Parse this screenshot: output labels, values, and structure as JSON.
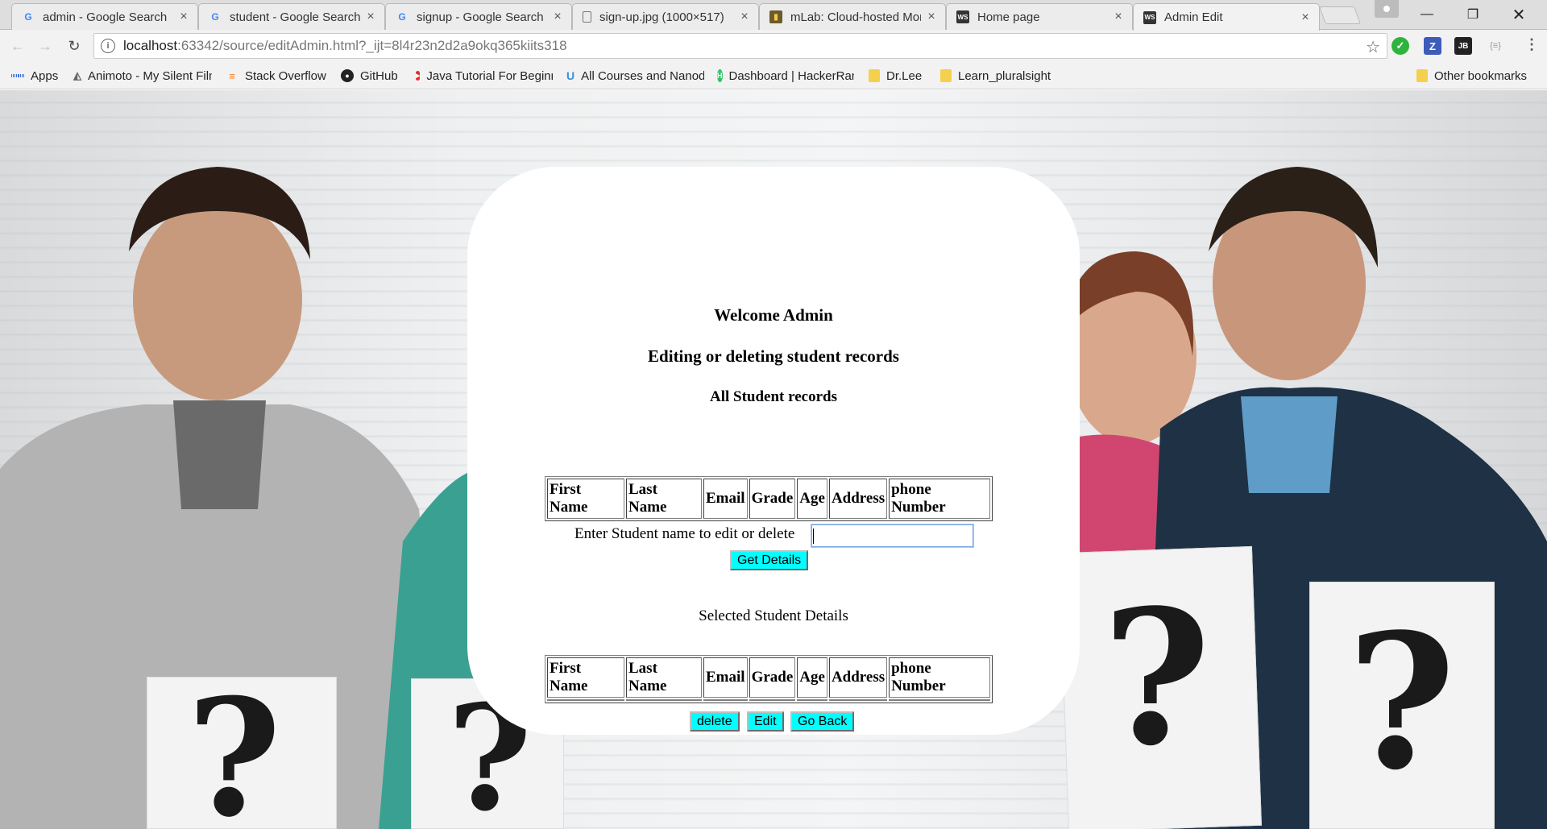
{
  "browser": {
    "tabs": [
      {
        "title": "admin - Google Search",
        "icon": "google-icon"
      },
      {
        "title": "student - Google Search",
        "icon": "google-icon"
      },
      {
        "title": "signup - Google Search",
        "icon": "google-icon"
      },
      {
        "title": "sign-up.jpg (1000×517)",
        "icon": "document-icon"
      },
      {
        "title": "mLab: Cloud-hosted MongoDB",
        "icon": "mlab-icon"
      },
      {
        "title": "Home page",
        "icon": "webstorm-icon"
      },
      {
        "title": "Admin Edit",
        "icon": "webstorm-icon",
        "active": true
      }
    ],
    "address": {
      "host": "localhost",
      "path": ":63342/source/editAdmin.html?_ijt=8l4r23n2d2a9okq365kiits318"
    },
    "bookmarks": [
      {
        "label": "Apps",
        "icon": "apps-grid-icon"
      },
      {
        "label": "Animoto - My Silent Film",
        "icon": "animoto-icon"
      },
      {
        "label": "Stack Overflow",
        "icon": "stackoverflow-icon"
      },
      {
        "label": "GitHub",
        "icon": "github-icon"
      },
      {
        "label": "Java Tutorial For Beginners",
        "icon": "youtube-icon"
      },
      {
        "label": "All Courses and Nanodegrees",
        "icon": "udacity-icon"
      },
      {
        "label": "Dashboard | HackerRank",
        "icon": "hackerrank-icon"
      },
      {
        "label": "Dr.Lee",
        "icon": "folder-icon"
      },
      {
        "label": "Learn_pluralsight",
        "icon": "folder-icon"
      }
    ],
    "other_bookmarks": "Other bookmarks"
  },
  "page": {
    "welcome": "Welcome Admin",
    "subtitle": "Editing or deleting student records",
    "all_records_heading": "All Student records",
    "columns": [
      "First Name",
      "Last Name",
      "Email",
      "Grade",
      "Age",
      "Address",
      "phone Number"
    ],
    "search_prompt": "Enter Student name to edit or delete",
    "search_value": "",
    "get_details_label": "Get Details",
    "selected_heading": "Selected Student Details",
    "delete_label": "delete",
    "edit_label": "Edit",
    "go_back_label": "Go Back"
  }
}
